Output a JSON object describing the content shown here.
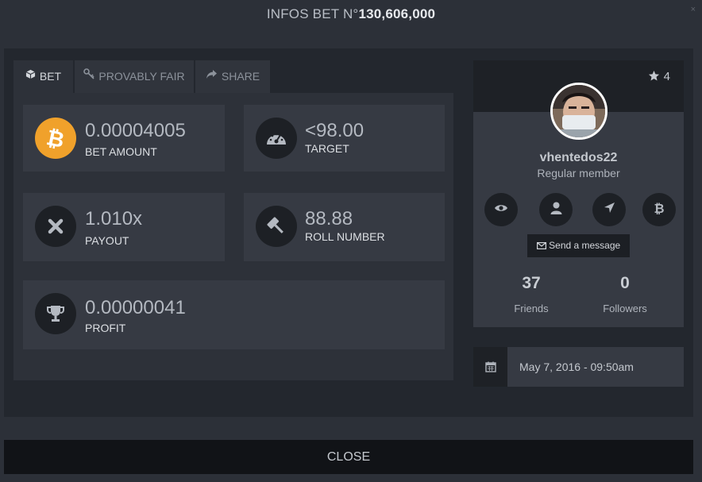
{
  "modal": {
    "title_prefix": "INFOS BET N°",
    "title_number": "130,606,000",
    "close_x": "×",
    "close_button": "CLOSE"
  },
  "tabs": [
    {
      "label": "BET",
      "icon": "cube-icon",
      "active": true
    },
    {
      "label": "PROVABLY FAIR",
      "icon": "key-icon",
      "active": false
    },
    {
      "label": "SHARE",
      "icon": "share-arrow-icon",
      "active": false
    }
  ],
  "bet": {
    "amount": {
      "value": "0.00004005",
      "label": "BET AMOUNT",
      "icon": "bitcoin-icon"
    },
    "target": {
      "value": "<98.00",
      "label": "TARGET",
      "icon": "speedometer-icon"
    },
    "payout": {
      "value": "1.010x",
      "label": "PAYOUT",
      "icon": "times-icon"
    },
    "roll": {
      "value": "88.88",
      "label": "ROLL NUMBER",
      "icon": "gavel-icon"
    },
    "profit": {
      "value": "0.00000041",
      "label": "PROFIT",
      "icon": "trophy-icon"
    }
  },
  "profile": {
    "stars": "4",
    "username": "vhentedos22",
    "role": "Regular member",
    "send_message": "Send a message",
    "friends_count": "37",
    "friends_label": "Friends",
    "followers_count": "0",
    "followers_label": "Followers"
  },
  "date": {
    "text": "May 7, 2016 - 09:50am",
    "icon": "calendar-icon"
  },
  "colors": {
    "bitcoin_orange": "#f0a12b",
    "panel_bg": "#23272e",
    "card_bg": "#363a43"
  }
}
